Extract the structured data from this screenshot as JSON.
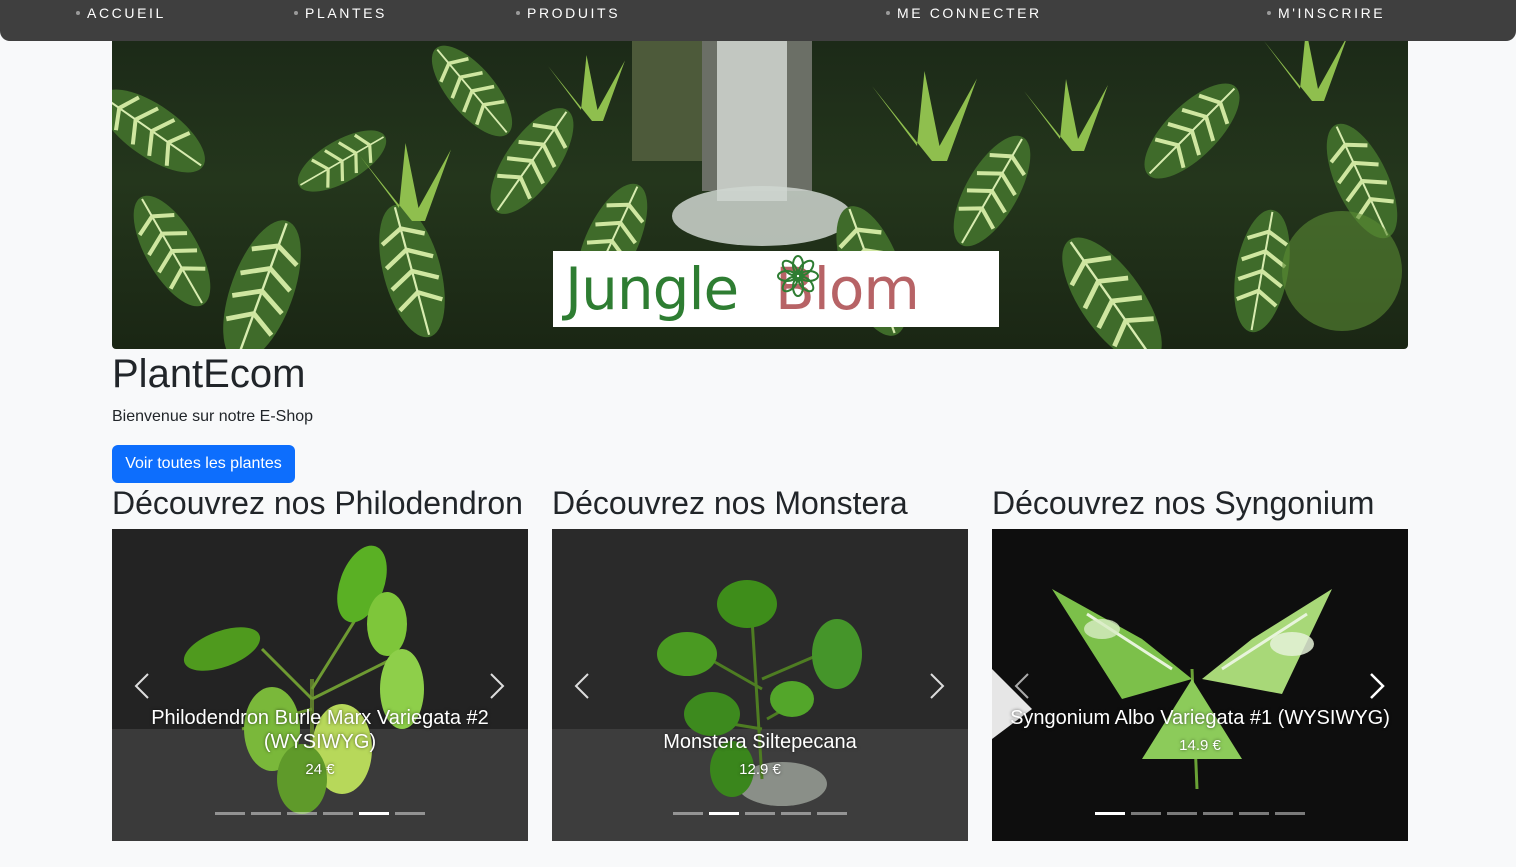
{
  "nav": {
    "items": [
      {
        "label": "ACCUEIL"
      },
      {
        "label": "PLANTES"
      },
      {
        "label": "PRODUITS"
      },
      {
        "label": "ME CONNECTER"
      },
      {
        "label": "M'INSCRIRE"
      }
    ]
  },
  "hero": {
    "logo_part1": "Jungle",
    "logo_part2": "Bl",
    "logo_part3": "om",
    "logo_icon": "flower-icon"
  },
  "site": {
    "title": "PlantEcom",
    "subtitle": "Bienvenue sur notre E-Shop",
    "button_label": "Voir toutes les plantes"
  },
  "sections": [
    {
      "title": "Découvrez nos Philodendron",
      "caption": "Philodendron Burle Marx Variegata #2 (WYSIWYG)",
      "price": "24 €",
      "slides": 6,
      "active": 4
    },
    {
      "title": "Découvrez nos Monstera",
      "caption": "Monstera Siltepecana",
      "price": "12.9 €",
      "slides": 5,
      "active": 1
    },
    {
      "title": "Découvrez nos Syngonium",
      "caption": "Syngonium Albo Variegata #1 (WYSIWYG)",
      "price": "14.9 €",
      "slides": 6,
      "active": 0
    }
  ],
  "icons": {
    "prev": "chevron-left-icon",
    "next": "chevron-right-icon"
  },
  "colors": {
    "nav_bg": "#3f3f3f",
    "primary": "#0d6efd",
    "logo_green": "#2e7d32",
    "logo_pink": "#b76366"
  }
}
